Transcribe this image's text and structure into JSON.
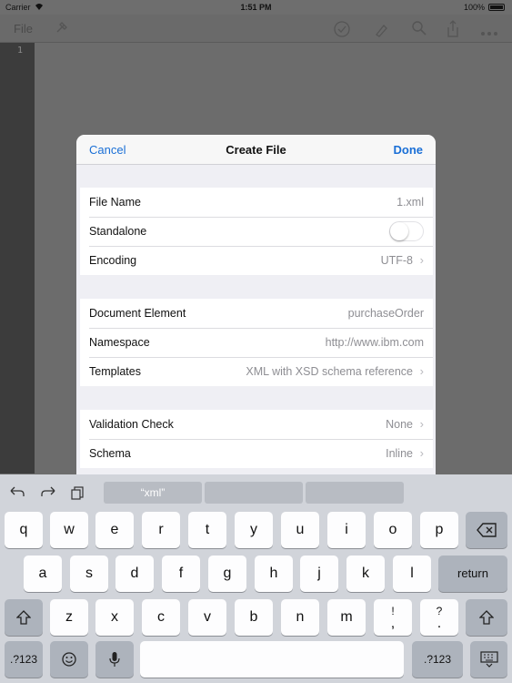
{
  "status_bar": {
    "carrier": "Carrier",
    "time": "1:51 PM",
    "battery": "100%"
  },
  "toolbar": {
    "file_label": "File"
  },
  "editor": {
    "line_numbers": [
      "1"
    ]
  },
  "dialog": {
    "title": "Create File",
    "cancel_label": "Cancel",
    "done_label": "Done",
    "groups": [
      {
        "rows": [
          {
            "label": "File Name",
            "value": "1.xml"
          },
          {
            "label": "Standalone",
            "toggle": false
          },
          {
            "label": "Encoding",
            "value": "UTF-8",
            "chevron": true
          }
        ]
      },
      {
        "rows": [
          {
            "label": "Document Element",
            "value": "purchaseOrder"
          },
          {
            "label": "Namespace",
            "value": "http://www.ibm.com"
          },
          {
            "label": "Templates",
            "value": "XML with XSD schema reference",
            "chevron": true
          }
        ]
      },
      {
        "rows": [
          {
            "label": "Validation Check",
            "value": "None",
            "chevron": true
          },
          {
            "label": "Schema",
            "value": "Inline",
            "chevron": true
          }
        ]
      }
    ]
  },
  "keyboard": {
    "suggestions": [
      "“xml”",
      "",
      ""
    ],
    "row1": [
      "q",
      "w",
      "e",
      "r",
      "t",
      "y",
      "u",
      "i",
      "o",
      "p"
    ],
    "row2": [
      "a",
      "s",
      "d",
      "f",
      "g",
      "h",
      "j",
      "k",
      "l"
    ],
    "row3": [
      "z",
      "x",
      "c",
      "v",
      "b",
      "n",
      "m"
    ],
    "return_label": "return",
    "numbers_label": ".?123",
    "punct_1": "!",
    "punct_1_alt": ",",
    "punct_2": "?",
    "punct_2_alt": "."
  },
  "colors": {
    "accent": "#1a6fd6",
    "keyboard_bg": "#d1d4da"
  }
}
